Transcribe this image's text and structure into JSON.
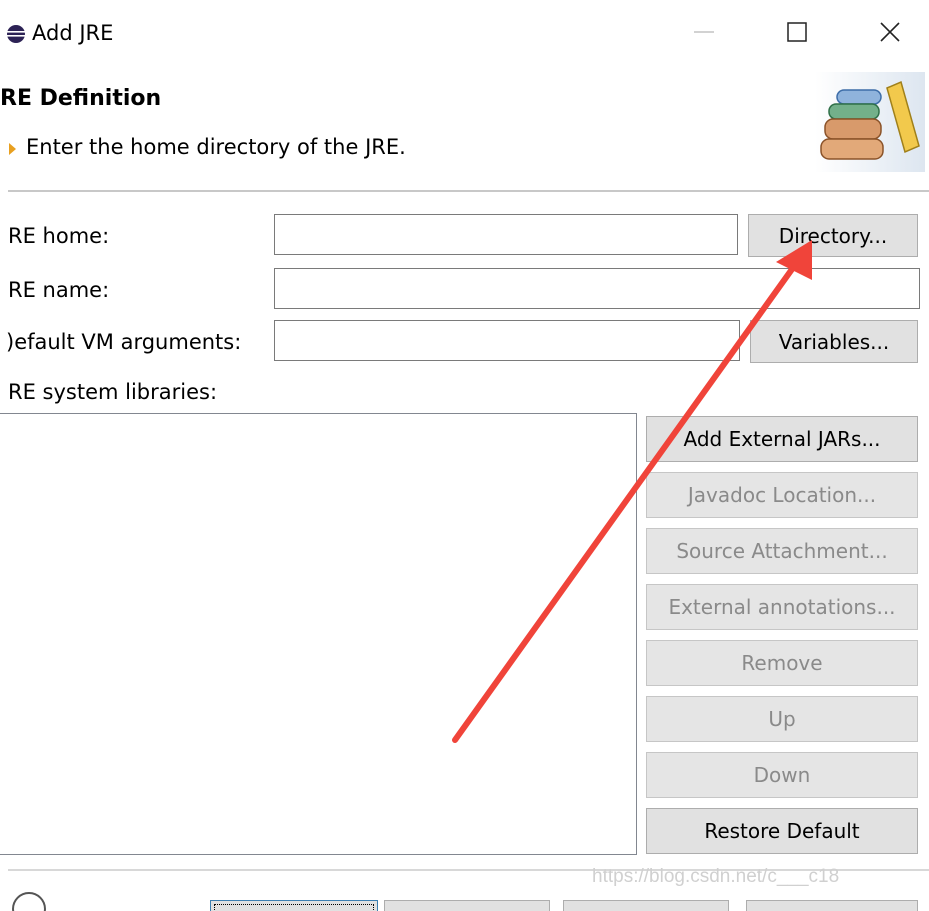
{
  "window": {
    "title": "Add JRE"
  },
  "banner": {
    "title": "RE Definition",
    "message": "Enter the home directory of the JRE."
  },
  "form": {
    "jre_home_label": "RE home:",
    "jre_home_value": "",
    "directory_button": "Directory...",
    "jre_name_label": "RE name:",
    "jre_name_value": "",
    "vm_args_label": ")efault VM arguments:",
    "vm_args_value": "",
    "variables_button": "Variables...",
    "libraries_label": "RE system libraries:"
  },
  "library_buttons": [
    {
      "label": "Add External JARs...",
      "enabled": true
    },
    {
      "label": "Javadoc Location...",
      "enabled": false
    },
    {
      "label": "Source Attachment...",
      "enabled": false
    },
    {
      "label": "External annotations...",
      "enabled": false
    },
    {
      "label": "Remove",
      "enabled": false
    },
    {
      "label": "Up",
      "enabled": false
    },
    {
      "label": "Down",
      "enabled": false
    },
    {
      "label": "Restore Default",
      "enabled": true
    }
  ],
  "watermark": "https://blog.csdn.net/c___c18",
  "icons": {
    "app": "eclipse-icon",
    "banner": "library-books-icon",
    "message": "info-arrow-icon",
    "help": "help-icon"
  },
  "colors": {
    "annotation_arrow": "#f0443a",
    "button_face": "#e1e1e1",
    "disabled_text": "#8a8a8a"
  }
}
